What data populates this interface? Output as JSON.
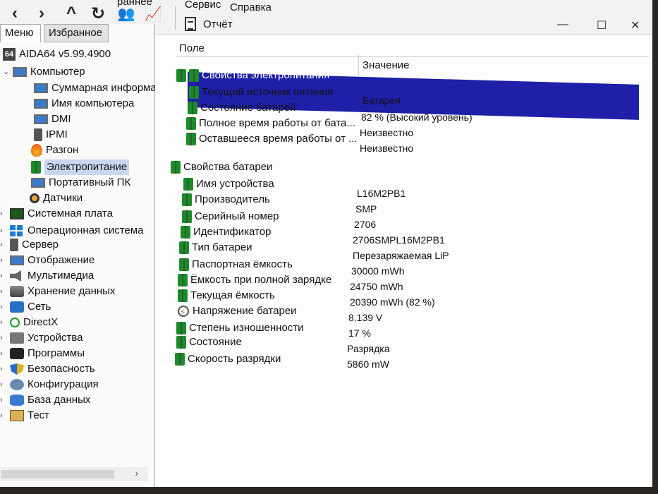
{
  "toolbar": {
    "menu_partial_left": "раннее",
    "menu_service": "Сервис",
    "menu_help": "Справка",
    "report_label": "Отчёт"
  },
  "tabs": {
    "menu": "Меню",
    "favorites": "Избранное"
  },
  "tree": {
    "root": "AIDA64 v5.99.4900",
    "items": [
      {
        "label": "Компьютер",
        "icon": "monitor-icon"
      },
      {
        "label": "Суммарная информа",
        "icon": "monitor-icon"
      },
      {
        "label": "Имя компьютера",
        "icon": "monitor-icon"
      },
      {
        "label": "DMI",
        "icon": "monitor-icon"
      },
      {
        "label": "IPMI",
        "icon": "server-icon"
      },
      {
        "label": "Разгон",
        "icon": "flame-icon"
      },
      {
        "label": "Электропитание",
        "icon": "battery-icon"
      },
      {
        "label": "Портативный ПК",
        "icon": "monitor-icon"
      },
      {
        "label": "Датчики",
        "icon": "gauge-icon"
      },
      {
        "label": "Системная плата",
        "icon": "chip-icon"
      },
      {
        "label": "Операционная система",
        "icon": "windows-icon"
      },
      {
        "label": "Сервер",
        "icon": "server-icon"
      },
      {
        "label": "Отображение",
        "icon": "monitor-icon"
      },
      {
        "label": "Мультимедиа",
        "icon": "speaker-icon"
      },
      {
        "label": "Хранение данных",
        "icon": "disk-icon"
      },
      {
        "label": "Сеть",
        "icon": "network-icon"
      },
      {
        "label": "DirectX",
        "icon": "xbox-icon"
      },
      {
        "label": "Устройства",
        "icon": "devices-icon"
      },
      {
        "label": "Программы",
        "icon": "programs-icon"
      },
      {
        "label": "Безопасность",
        "icon": "shield-icon"
      },
      {
        "label": "Конфигурация",
        "icon": "config-icon"
      },
      {
        "label": "База данных",
        "icon": "database-icon"
      },
      {
        "label": "Тест",
        "icon": "test-icon"
      }
    ]
  },
  "columns": {
    "field": "Поле",
    "value": "Значение"
  },
  "power_section": {
    "title": "Свойства электропитания",
    "rows": [
      {
        "field": "Текущий источник питания",
        "value": "Батарея"
      },
      {
        "field": "Состояние батарей",
        "value": "82 % (Высокий уровень)"
      },
      {
        "field": "Полное время работы от бата...",
        "value": "Неизвестно"
      },
      {
        "field": "Оставшееся время работы от ...",
        "value": "Неизвестно"
      }
    ]
  },
  "battery_section": {
    "title": "Свойства батареи",
    "rows": [
      {
        "field": "Имя устройства",
        "value": "L16M2PB1"
      },
      {
        "field": "Производитель",
        "value": "SMP"
      },
      {
        "field": "Серийный номер",
        "value": "2706"
      },
      {
        "field": "Идентификатор",
        "value": "2706SMPL16M2PB1"
      },
      {
        "field": "Тип батареи",
        "value": "Перезаряжаемая LiP"
      },
      {
        "field": "Паспортная ёмкость",
        "value": "30000 mWh"
      },
      {
        "field": "Ёмкость при полной зарядке",
        "value": "24750 mWh"
      },
      {
        "field": "Текущая ёмкость",
        "value": "20390 mWh  (82 %)"
      },
      {
        "field": "Напряжение батареи",
        "value": "8.139 V"
      },
      {
        "field": "Степень изношенности",
        "value": "17 %"
      },
      {
        "field": "Состояние",
        "value": "Разрядка"
      },
      {
        "field": "Скорость разрядки",
        "value": "5860 mW"
      }
    ]
  },
  "colors": {
    "selection": "#1f1fa8",
    "tree_selected": "#c8d7ee"
  }
}
